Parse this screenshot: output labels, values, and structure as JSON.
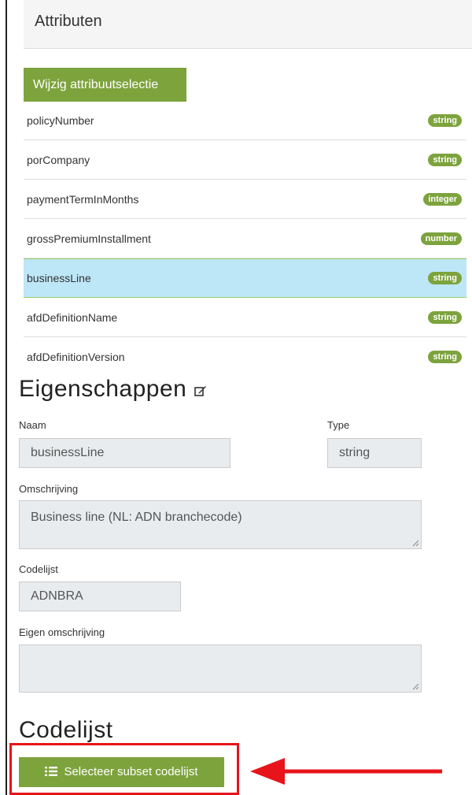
{
  "attributes_panel": {
    "title": "Attributen",
    "change_selection_button": "Wijzig attribuutselectie",
    "items": [
      {
        "name": "policyNumber",
        "type": "string"
      },
      {
        "name": "porCompany",
        "type": "string"
      },
      {
        "name": "paymentTermInMonths",
        "type": "integer"
      },
      {
        "name": "grossPremiumInstallment",
        "type": "number"
      },
      {
        "name": "businessLine",
        "type": "string",
        "selected": true
      },
      {
        "name": "afdDefinitionName",
        "type": "string"
      },
      {
        "name": "afdDefinitionVersion",
        "type": "string"
      }
    ]
  },
  "properties": {
    "title": "Eigenschappen",
    "name_label": "Naam",
    "name_value": "businessLine",
    "type_label": "Type",
    "type_value": "string",
    "description_label": "Omschrijving",
    "description_value": "Business line (NL: ADN branchecode)",
    "codelist_label": "Codelijst",
    "codelist_value": "ADNBRA",
    "own_description_label": "Eigen omschrijving",
    "own_description_value": ""
  },
  "codelist_section": {
    "title": "Codelijst",
    "select_subset_button": "Selecteer subset codelijst"
  },
  "colors": {
    "accent_green": "#7da33d",
    "selected_row": "#bde6f7",
    "highlight_red": "#e8141b"
  }
}
